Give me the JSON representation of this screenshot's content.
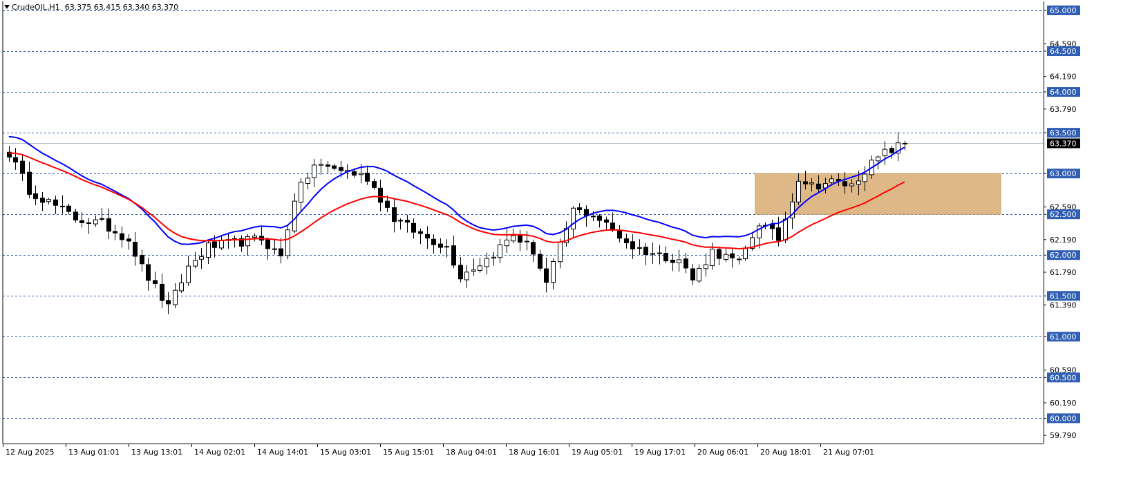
{
  "header": {
    "symbol_timeframe": "CrudeOIL,H1",
    "ohlc": "63.375 63.415 63.340 63.370",
    "menu_icon": "triangle-down-icon"
  },
  "chart_data": {
    "type": "candlestick",
    "symbol": "CrudeOIL",
    "timeframe": "H1",
    "current_price": 63.37,
    "ylim": [
      59.69,
      65.11
    ],
    "y_ticks": [
      "65.000",
      "64.590",
      "64.500",
      "64.190",
      "64.000",
      "63.790",
      "63.500",
      "63.000",
      "62.590",
      "62.500",
      "62.190",
      "62.000",
      "61.790",
      "61.500",
      "61.390",
      "61.000",
      "60.590",
      "60.500",
      "60.190",
      "60.000",
      "59.790"
    ],
    "x_ticks": [
      "12 Aug 2025",
      "13 Aug 01:01",
      "13 Aug 13:01",
      "14 Aug 02:01",
      "14 Aug 14:01",
      "15 Aug 03:01",
      "15 Aug 15:01",
      "18 Aug 04:01",
      "18 Aug 16:01",
      "19 Aug 05:01",
      "19 Aug 17:01",
      "20 Aug 06:01",
      "20 Aug 18:01",
      "21 Aug 07:01"
    ],
    "horizontal_levels": [
      "65.000",
      "64.500",
      "64.000",
      "63.500",
      "63.000",
      "62.500",
      "62.000",
      "61.500",
      "61.000",
      "60.500",
      "60.000"
    ],
    "zone": {
      "from_bar": 113,
      "to_bar": 150,
      "low": 62.5,
      "high": 63.0,
      "color": "#deb887"
    },
    "close_anchors": [
      [
        0,
        63.25
      ],
      [
        3,
        62.8
      ],
      [
        6,
        62.65
      ],
      [
        10,
        62.45
      ],
      [
        14,
        62.38
      ],
      [
        18,
        62.2
      ],
      [
        20,
        61.85
      ],
      [
        24,
        61.35
      ],
      [
        27,
        61.85
      ],
      [
        30,
        62.1
      ],
      [
        34,
        62.15
      ],
      [
        38,
        62.2
      ],
      [
        41,
        61.98
      ],
      [
        43,
        62.7
      ],
      [
        46,
        63.1
      ],
      [
        50,
        63.05
      ],
      [
        54,
        62.95
      ],
      [
        58,
        62.45
      ],
      [
        62,
        62.25
      ],
      [
        66,
        62.1
      ],
      [
        68,
        61.75
      ],
      [
        72,
        61.95
      ],
      [
        76,
        62.25
      ],
      [
        79,
        62.05
      ],
      [
        81,
        61.65
      ],
      [
        85,
        62.55
      ],
      [
        88,
        62.5
      ],
      [
        91,
        62.3
      ],
      [
        94,
        62.1
      ],
      [
        98,
        62.0
      ],
      [
        101,
        61.95
      ],
      [
        103,
        61.7
      ],
      [
        106,
        62.05
      ],
      [
        110,
        61.9
      ],
      [
        113,
        62.4
      ],
      [
        116,
        62.2
      ],
      [
        119,
        62.95
      ],
      [
        121,
        62.85
      ],
      [
        124,
        62.9
      ],
      [
        127,
        62.85
      ],
      [
        129,
        63.05
      ],
      [
        132,
        63.25
      ],
      [
        135,
        63.37
      ]
    ],
    "ema_fast_color": "#0000ff",
    "ema_slow_color": "#ff0000",
    "bull_color": "#ffffff",
    "bear_color": "#000000"
  }
}
